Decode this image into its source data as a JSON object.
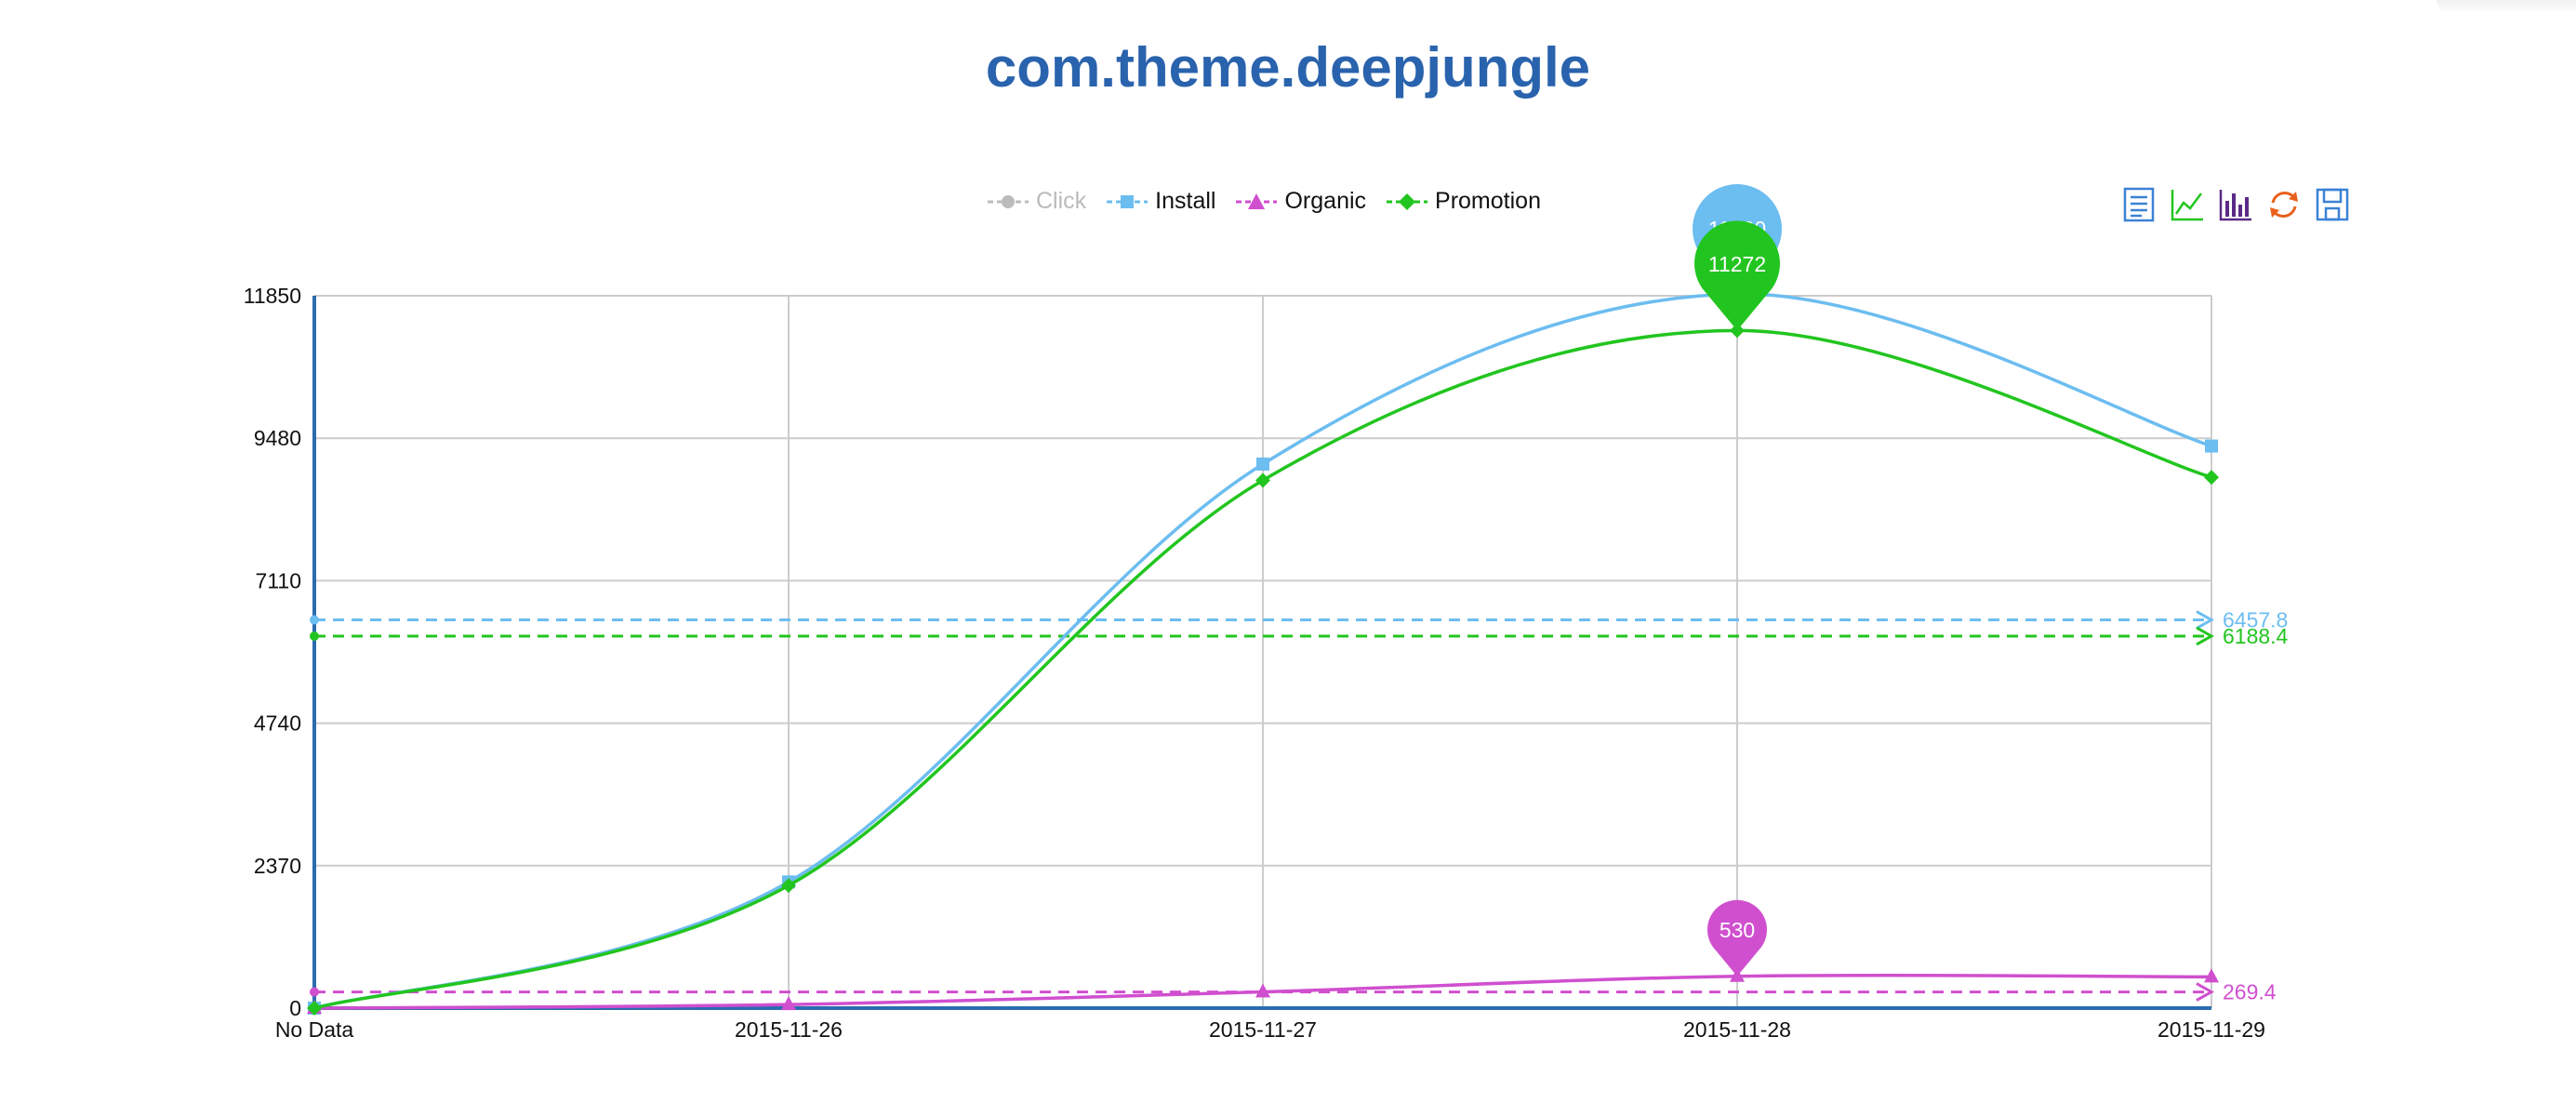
{
  "chart_data": {
    "type": "line",
    "title": "com.theme.deepjungle",
    "categories": [
      "No Data",
      "2015-11-26",
      "2015-11-27",
      "2015-11-28",
      "2015-11-29"
    ],
    "ylim": [
      0,
      11850
    ],
    "yticks": [
      "0",
      "2370",
      "4740",
      "7110",
      "9480",
      "11850"
    ],
    "grid": true,
    "legend_position": "top-center",
    "series": [
      {
        "name": "Click",
        "color": "#bbbbbb",
        "marker": "circle",
        "visible": false,
        "values": []
      },
      {
        "name": "Install",
        "color": "#6cbdf0",
        "marker": "square",
        "visible": true,
        "values": [
          0,
          2100,
          9050,
          11880,
          9350
        ],
        "max_label": "11880",
        "average": 6457.8,
        "average_label": "6457.8"
      },
      {
        "name": "Organic",
        "color": "#d04fcf",
        "marker": "triangle",
        "visible": true,
        "values": [
          0,
          60,
          270,
          530,
          520
        ],
        "max_label": "530",
        "average": 269.4,
        "average_label": "269.4"
      },
      {
        "name": "Promotion",
        "color": "#22c51f",
        "marker": "diamond",
        "visible": true,
        "values": [
          0,
          2040,
          8780,
          11272,
          8830
        ],
        "max_label": "11272",
        "average": 6188.4,
        "average_label": "6188.4"
      }
    ]
  },
  "toolbox": [
    "data-view-icon",
    "line-chart-icon",
    "bar-chart-icon",
    "restore-icon",
    "save-image-icon"
  ]
}
